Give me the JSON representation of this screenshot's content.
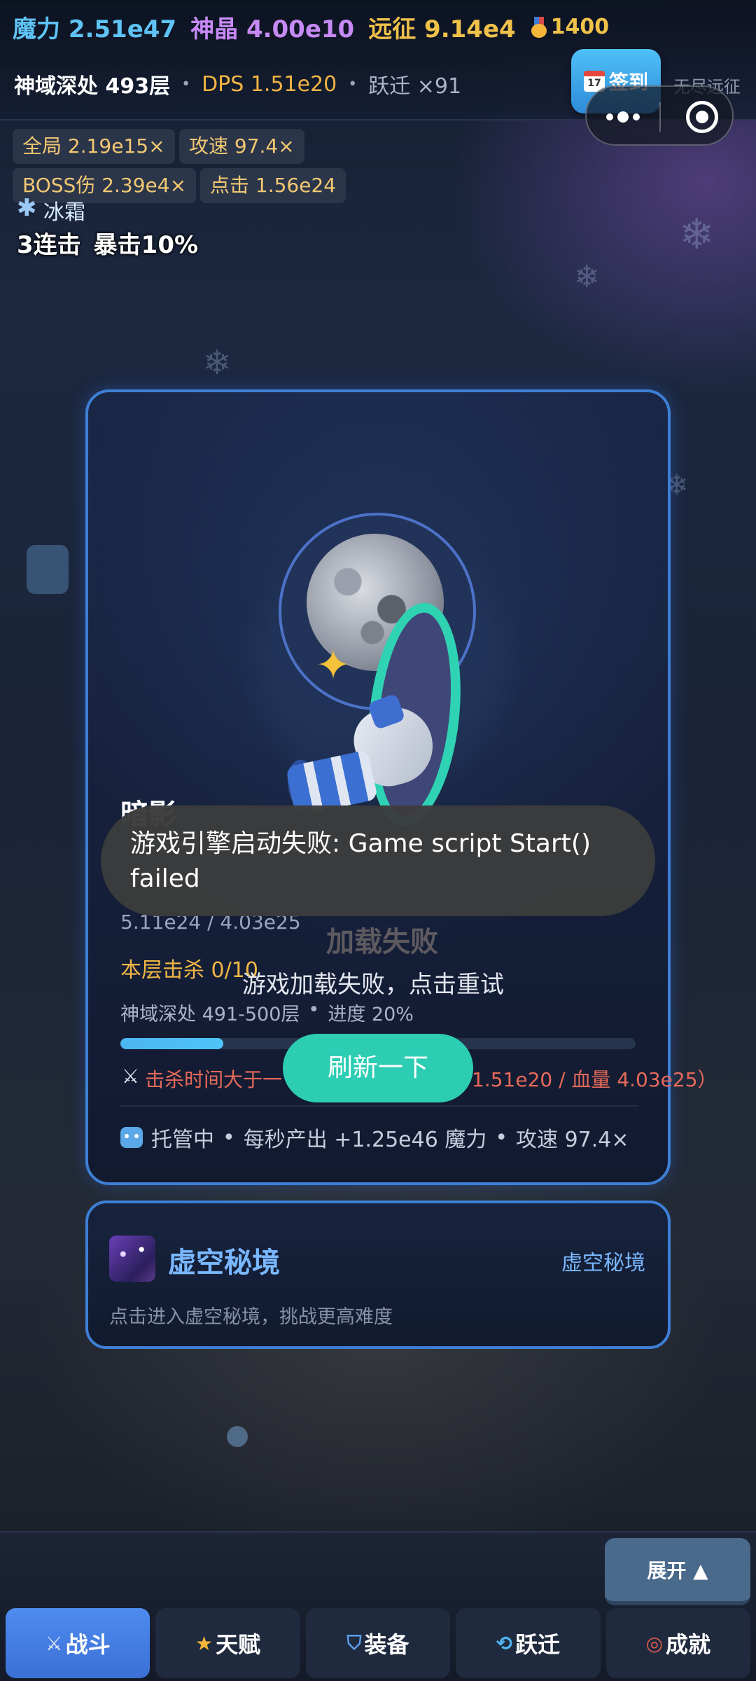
{
  "header": {
    "magic_label": "魔力 2.51e47",
    "crystal_label": "神晶 4.00e10",
    "expedition_label": "远征 9.14e4",
    "medal_value": "1400",
    "floor_label": "神域深处 493层",
    "sep": "•",
    "dps_label": "DPS 1.51e20",
    "jump_label": "跃迁 ×91",
    "checkin_label": "签到",
    "calendar_day": "17",
    "endless_label": "无尽远征"
  },
  "buffs": {
    "global": "全局 2.19e15×",
    "atk_speed": "攻速 97.4×",
    "boss_dmg": "BOSS伤 2.39e4×",
    "click": "点击 1.56e24",
    "frost": "冰霜",
    "combo": "3连击",
    "crit": "暴击10%"
  },
  "battle": {
    "boss_name": "暗影",
    "hp_text": "5.11e24 / 4.03e25",
    "load_fail": "加载失败",
    "kills": "本层击杀 0/10",
    "retry_hint": "游戏加载失败，点击重试",
    "range_label": "神域深处 491-500层",
    "sep": "•",
    "progress_label": "进度 20%",
    "progress_value": 0.2,
    "warn_left": "击杀时间大于一",
    "warn_right": "1.51e20 / 血量 4.03e25）",
    "auto_label": "托管中",
    "auto_output": "每秒产出 +1.25e46 魔力",
    "auto_speed": "攻速 97.4×",
    "refresh_label": "刷新一下"
  },
  "toast": {
    "message": "游戏引擎启动失败: Game script Start() failed"
  },
  "void_realm": {
    "title": "虚空秘境",
    "link": "虚空秘境",
    "desc": "点击进入虚空秘境，挑战更高难度"
  },
  "bottom": {
    "expand_label": "展开 ▲",
    "nav": [
      {
        "label": "战斗",
        "icon": "swords-icon",
        "glyph": "⚔"
      },
      {
        "label": "天赋",
        "icon": "star-icon",
        "glyph": "★"
      },
      {
        "label": "装备",
        "icon": "shield-icon",
        "glyph": "⛉"
      },
      {
        "label": "跃迁",
        "icon": "cycle-icon",
        "glyph": "⟲"
      },
      {
        "label": "成就",
        "icon": "target-icon",
        "glyph": "◎"
      }
    ]
  },
  "colors": {
    "accent_teal": "#2ccdb3",
    "accent_blue": "#3e7fd6",
    "magic": "#5fc4f5",
    "crystal": "#c78af5",
    "gold": "#f0c24a",
    "warn": "#e76a5a"
  }
}
